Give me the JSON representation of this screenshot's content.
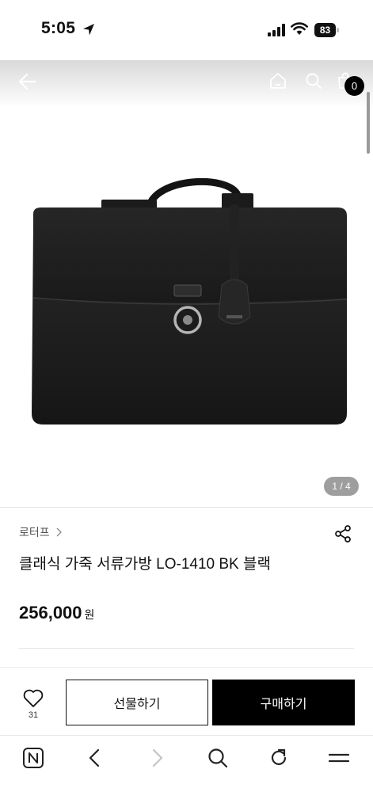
{
  "status_bar": {
    "time": "5:05",
    "battery": "83"
  },
  "nav": {
    "cart_count": "0"
  },
  "gallery": {
    "page_indicator": "1 / 4"
  },
  "product": {
    "brand": "로터프",
    "title": "클래식 가죽 서류가방 LO-1410 BK 블랙",
    "price": "256,000",
    "currency": "원"
  },
  "actions": {
    "like_count": "31",
    "gift_label": "선물하기",
    "buy_label": "구매하기"
  },
  "icons": {
    "back": "arrow-left-icon",
    "home": "home-icon",
    "search": "search-icon",
    "cart": "shopping-bag-icon",
    "share": "share-icon",
    "like": "heart-icon",
    "browser": [
      "naver-n-icon",
      "chevron-left-icon",
      "chevron-right-icon",
      "search-icon",
      "refresh-icon",
      "menu-icon"
    ]
  },
  "colors": {
    "primary": "#000000",
    "badge": "#000000",
    "pill": "#9e9e9e",
    "divider": "#e4e4e4"
  }
}
